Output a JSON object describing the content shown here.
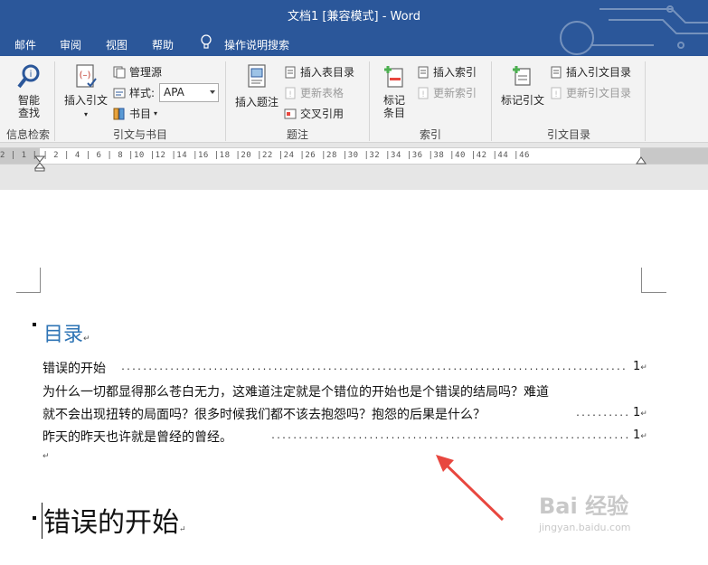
{
  "window": {
    "title": "文档1 [兼容模式]  -  Word"
  },
  "tabs": [
    "邮件",
    "审阅",
    "视图",
    "帮助",
    "操作说明搜索"
  ],
  "ribbon": {
    "info_search": {
      "button": "智能\n查找",
      "group": "信息检索"
    },
    "citations": {
      "insert_citation": "插入引文",
      "manage_sources": "管理源",
      "style_label": "样式:",
      "style_value": "APA",
      "bibliography": "书目",
      "group": "引文与书目"
    },
    "captions": {
      "insert_caption": "插入题注",
      "insert_table_of_figures": "插入表目录",
      "update_table": "更新表格",
      "cross_reference": "交叉引用",
      "group": "题注"
    },
    "index": {
      "mark_entry": "标记\n条目",
      "insert_index": "插入索引",
      "update_index": "更新索引",
      "group": "索引"
    },
    "table_of_authorities": {
      "mark_citation": "标记引文",
      "insert_toa": "插入引文目录",
      "update_toa": "更新引文目录",
      "group": "引文目录"
    }
  },
  "ruler": {
    "ticks": "2 | 1 |   | 2 | 4 | 6 | 8 |10 |12 |14 |16 |18 |20 |22 |24 |26 |28 |30 |32 |34 |36 |38 |40 |42 |44 |46"
  },
  "document": {
    "toc_heading": "目录",
    "toc_entries": [
      {
        "text": "错误的开始",
        "page": "1"
      },
      {
        "text_line1": "为什么一切都显得那么苍白无力，这难道注定就是个错位的开始也是个错误的结局吗？难道",
        "text_line2": "就不会出现扭转的局面吗？很多时候我们都不该去抱怨吗？抱怨的后果是什么？",
        "page": "1"
      },
      {
        "text": "昨天的昨天也许就是曾经的曾经。",
        "page": "1"
      }
    ],
    "heading1": "错误的开始",
    "paragraph_mark": "↵"
  },
  "annotation": {
    "arrow_color": "#e8473f"
  },
  "watermark": {
    "line1": "Bai 经验",
    "line2": "jingyan.baidu.com"
  },
  "colors": {
    "accent": "#2b579a",
    "heading": "#2e74b5"
  }
}
